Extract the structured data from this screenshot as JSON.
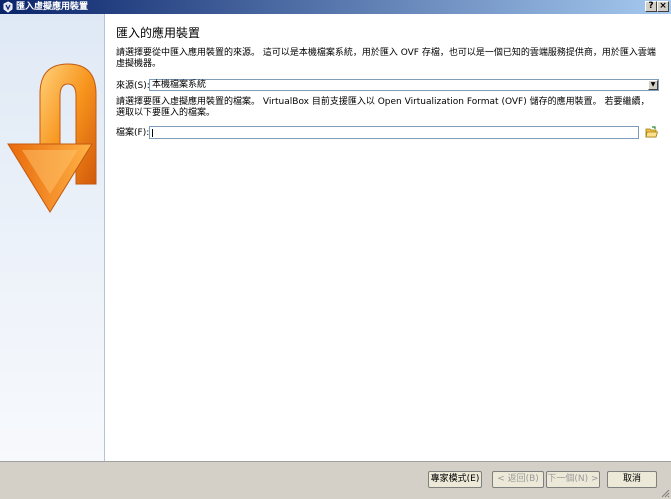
{
  "window": {
    "title": "匯入虛擬應用裝置",
    "help_label": "?",
    "close_label": "×"
  },
  "page": {
    "heading": "匯入的應用裝置",
    "intro": "請選擇要從中匯入應用裝置的來源。 這可以是本機檔案系統，用於匯入 OVF 存檔，也可以是一個已知的雲端服務提供商，用於匯入雲端虛擬機器。",
    "source_label": "來源(S):",
    "source_value": "本機檔案系統",
    "file_help": "請選擇要匯入虛擬應用裝置的檔案。 VirtualBox 目前支援匯入以 Open Virtualization Format (OVF) 儲存的應用裝置。 若要繼續，選取以下要匯入的檔案。",
    "file_label": "檔案(F):",
    "file_value": ""
  },
  "buttons": {
    "expert": "專家模式(E)",
    "back": "< 返回(B)",
    "next": "下一個(N) >",
    "cancel": "取消"
  },
  "icons": {
    "app": "virtualbox-icon",
    "banner": "import-arrow-icon",
    "browse": "folder-open-icon"
  },
  "colors": {
    "titlebar_start": "#0a246a",
    "titlebar_end": "#a6caf0",
    "banner_orange": "#f28a12"
  }
}
